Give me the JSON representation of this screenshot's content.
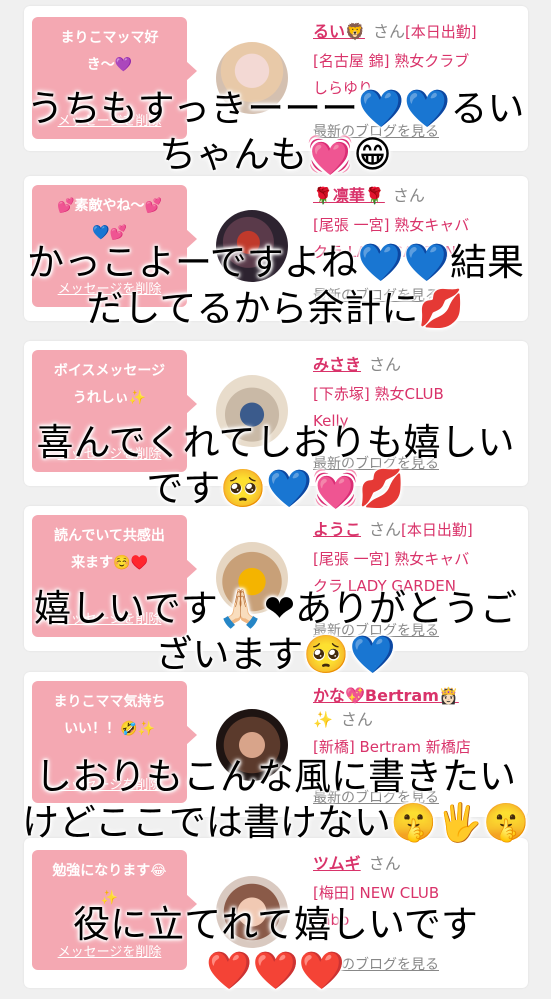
{
  "delete_label": "メッセージを削除",
  "blog_label": "最新のブログを見る",
  "san_label": "さん",
  "rows": [
    {
      "bubble": "まりこマッマ好\nき〜💜",
      "name": "るい🦁",
      "status": "[本日出勤]",
      "shop": "[名古屋 錦] 熟女クラブ\nしらゆり",
      "overlay": "うちもすっきーーー💙💙るい\nちゃんも💓😁"
    },
    {
      "bubble": "💕素敵やね〜💕\n💙💕",
      "name": "🌹凛華🌹",
      "status": "",
      "shop": "[尾張 一宮] 熟女キャバ\nクラ LADY GARDEN",
      "overlay": "かっこよーですよね💙💙結果\nだしてるから余計に💋"
    },
    {
      "bubble": "ボイスメッセージ\nうれしぃ✨",
      "name": "みさき",
      "status": "",
      "shop": "[下赤塚] 熟女CLUB\nKelly",
      "overlay": "喜んでくれてしおりも嬉しい\nです🥺💙💓💋"
    },
    {
      "bubble": "読んでいて共感出\n来ます☺️♥️",
      "name": "ようこ",
      "status": "[本日出勤]",
      "shop": "[尾張 一宮] 熟女キャバ\nクラ LADY GARDEN",
      "overlay": "嬉しいです🙏🏻❤ありがとうご\nざいます🥺💙"
    },
    {
      "bubble": "まりこママ気持ち\nいい！！🤣✨",
      "name": "かな💖Bertram👸🏻",
      "name2": "✨",
      "status": "",
      "shop": "[新橋] Bertram 新橋店",
      "overlay": "しおりもこんな風に書きたい\nけどここでは書けない🤫🖐🤫"
    },
    {
      "bubble": "勉強になります😂\n✨",
      "name": "ツムギ",
      "status": "",
      "shop": "[梅田] NEW CLUB\nLabo",
      "overlay": "役に立てれて嬉しいです\n❤️❤️❤️"
    }
  ],
  "colors": {
    "bubble": "#f4a8b2",
    "name": "#d9336a",
    "background": "#f0f0f0"
  }
}
